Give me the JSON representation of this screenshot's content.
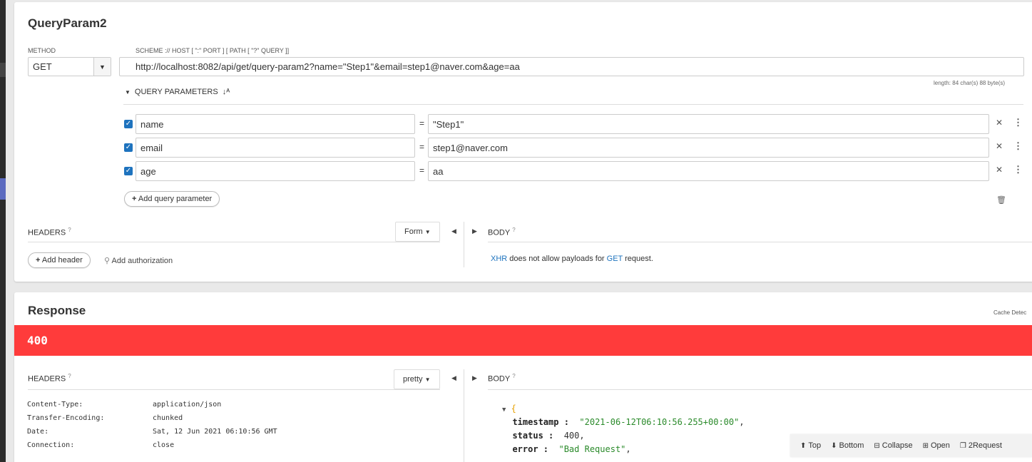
{
  "request": {
    "title": "QueryParam2",
    "method_label": "METHOD",
    "method": "GET",
    "scheme_label": "SCHEME :// HOST [ \":\" PORT ] [ PATH [ \"?\" QUERY ]]",
    "url": "http://localhost:8082/api/get/query-param2?name=\"Step1\"&email=step1@naver.com&age=aa",
    "length": "length: 84 char(s) 88 byte(s)",
    "query_params_label": "QUERY PARAMETERS",
    "params": [
      {
        "key": "name",
        "value": "\"Step1\"",
        "checked": true
      },
      {
        "key": "email",
        "value": "step1@naver.com",
        "checked": true
      },
      {
        "key": "age",
        "value": "aa",
        "checked": true
      }
    ],
    "eq": "=",
    "add_query_param": "Add query parameter",
    "headers_label": "HEADERS",
    "form_dropdown": "Form",
    "body_label": "BODY",
    "add_header": "Add header",
    "add_authorization": "Add authorization",
    "xhr_note": {
      "xhr": "XHR",
      "middle": " does not allow payloads for ",
      "get": "GET",
      "end": " request."
    }
  },
  "response": {
    "title": "Response",
    "cache": "Cache Detec",
    "status_code": "400",
    "headers_label": "HEADERS",
    "pretty_dropdown": "pretty",
    "body_label": "BODY",
    "headers": [
      {
        "k": "Content-Type:",
        "v": "application/json"
      },
      {
        "k": "Transfer-Encoding:",
        "v": "chunked"
      },
      {
        "k": "Date:",
        "v": "Sat, 12 Jun 2021 06:10:56 GMT"
      },
      {
        "k": "Connection:",
        "v": "close"
      }
    ],
    "json": {
      "open": "{",
      "timestamp_key": "timestamp :",
      "timestamp_val": "\"2021-06-12T06:10:56.255+00:00\"",
      "status_key": "status :",
      "status_val": "400",
      "error_key": "error :",
      "error_val": "\"Bad Request\""
    },
    "toolbar": {
      "top": "Top",
      "bottom": "Bottom",
      "collapse": "Collapse",
      "open": "Open",
      "request": "2Request"
    }
  },
  "colors": {
    "status_error": "#ff3b3b",
    "link": "#1e73be",
    "json_string": "#2a8a2a"
  }
}
